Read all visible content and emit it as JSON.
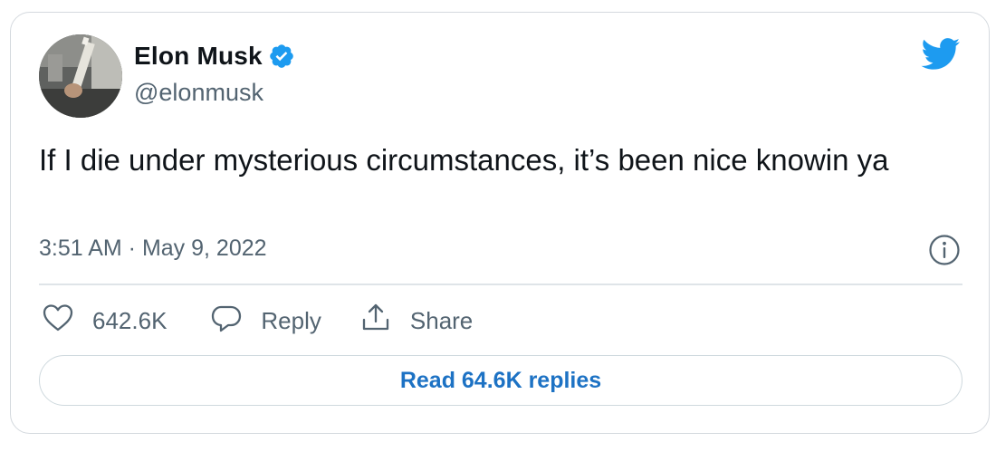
{
  "author": {
    "display_name": "Elon Musk",
    "handle": "@elonmusk",
    "verified": true
  },
  "tweet": {
    "text": "If I die under mysterious circumstances, it’s been nice knowin ya",
    "timestamp": "3:51 AM · May 9, 2022"
  },
  "actions": {
    "like_count": "642.6K",
    "reply_label": "Reply",
    "share_label": "Share"
  },
  "footer": {
    "read_replies_label": "Read 64.6K replies"
  },
  "icons": {
    "brand": "twitter-bird-icon",
    "verified": "verified-badge-icon",
    "info": "info-icon",
    "like": "heart-icon",
    "reply": "speech-bubble-icon",
    "share": "share-upload-icon"
  },
  "colors": {
    "brand_blue": "#1d9bf0",
    "link_blue": "#1d72c4",
    "text_primary": "#0f1419",
    "text_secondary": "#536471",
    "border": "#d4d9de"
  }
}
